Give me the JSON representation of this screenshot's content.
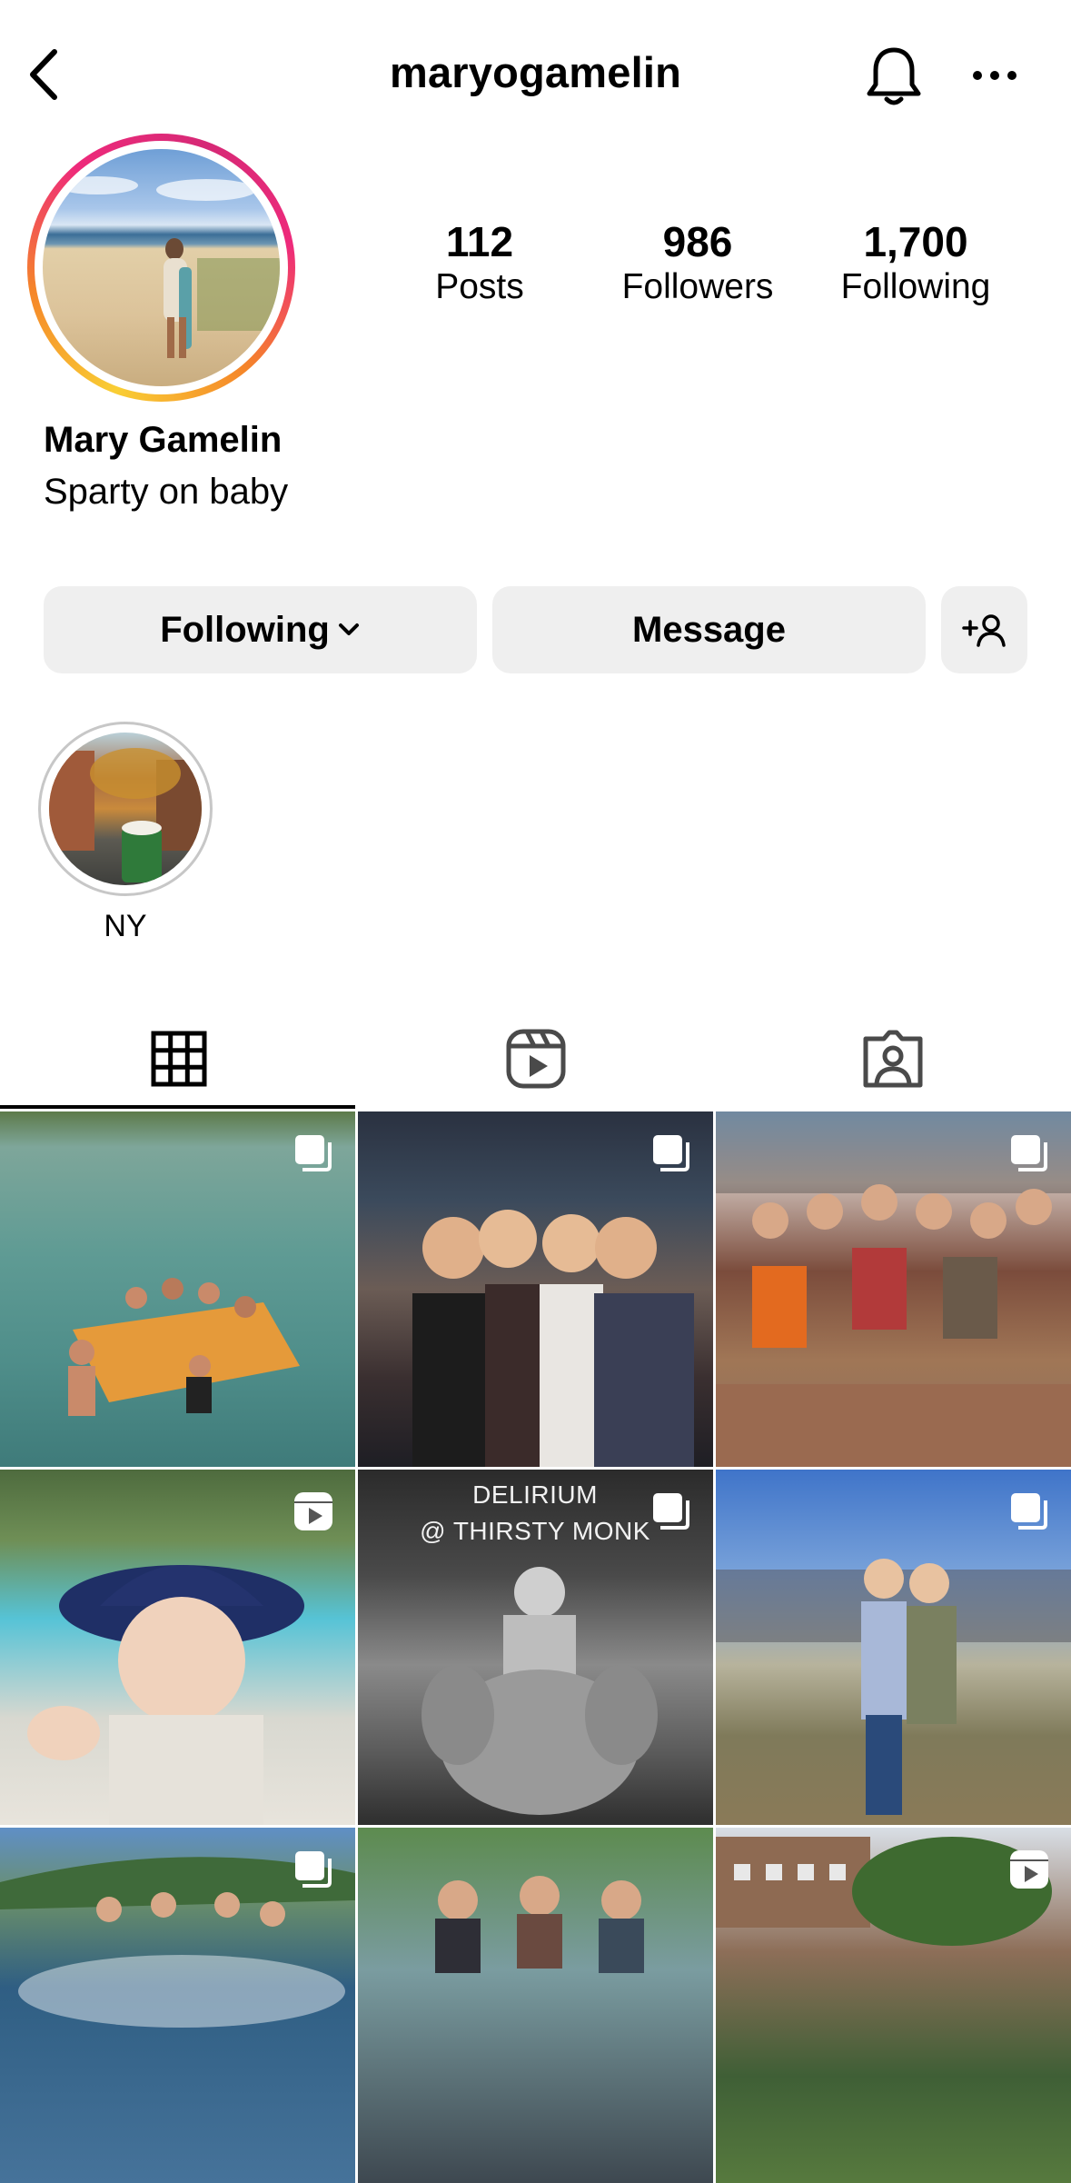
{
  "header": {
    "username": "maryogamelin",
    "icons": {
      "back": "chevron-left-icon",
      "notifications": "bell-icon",
      "more": "more-horizontal-icon"
    }
  },
  "profile": {
    "stats": [
      {
        "value": "112",
        "label": "Posts"
      },
      {
        "value": "986",
        "label": "Followers"
      },
      {
        "value": "1,700",
        "label": "Following"
      }
    ],
    "name": "Mary Gamelin",
    "bio": "Sparty on baby"
  },
  "actions": {
    "following_label": "Following",
    "message_label": "Message"
  },
  "highlights": [
    {
      "label": "NY"
    }
  ],
  "tabs": [
    {
      "name": "posts-grid",
      "icon": "grid-icon",
      "active": true
    },
    {
      "name": "reels",
      "icon": "reels-icon",
      "active": false
    },
    {
      "name": "tagged",
      "icon": "tagged-user-icon",
      "active": false
    }
  ],
  "posts": [
    {
      "type": "carousel"
    },
    {
      "type": "carousel"
    },
    {
      "type": "carousel"
    },
    {
      "type": "reel"
    },
    {
      "type": "carousel",
      "overlay_text_lines": [
        "DELIRIUM",
        "@ THIRSTY MONK"
      ]
    },
    {
      "type": "carousel"
    },
    {
      "type": "carousel"
    },
    {
      "type": "image"
    },
    {
      "type": "reel"
    }
  ],
  "colors": {
    "accent_ring": [
      "#f9ce34",
      "#ee2a7b"
    ],
    "button_bg": "#efefef"
  }
}
